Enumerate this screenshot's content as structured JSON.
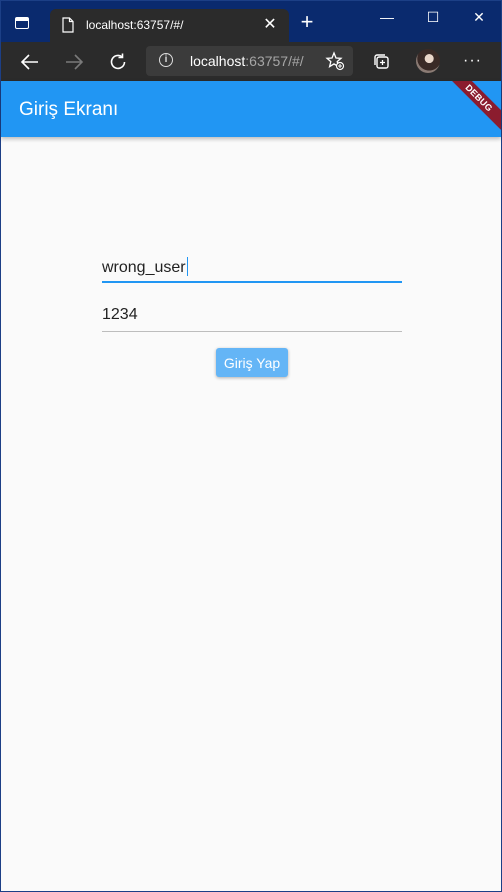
{
  "browser": {
    "tab": {
      "title": "localhost:63757/#/",
      "close_label": "✕"
    },
    "new_tab_label": "+",
    "window_controls": {
      "minimize": "—",
      "maximize": "☐",
      "close": "✕"
    },
    "address": {
      "host": "localhost",
      "rest": ":63757/#/"
    },
    "more_label": "···"
  },
  "app": {
    "title": "Giriş Ekranı",
    "debug_banner": "DEBUG",
    "username_value": "wrong_user",
    "password_value": "1234",
    "login_button_label": "Giriş Yap",
    "accent_color": "#2196f3"
  },
  "icons": [
    "tab-actions-icon",
    "page-icon",
    "back-arrow-icon",
    "forward-arrow-icon",
    "refresh-icon",
    "info-icon",
    "add-favorite-icon",
    "collections-icon",
    "profile-avatar",
    "more-icon"
  ]
}
